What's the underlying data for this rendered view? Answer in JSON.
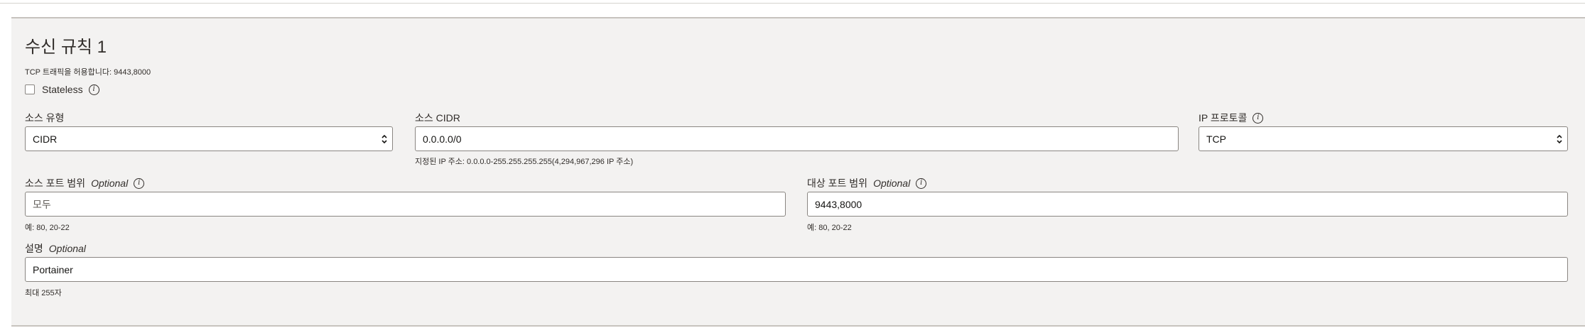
{
  "rule": {
    "title": "수신 규칙 1",
    "summary": "TCP 트래픽을 허용합니다: 9443,8000",
    "stateless_label": "Stateless"
  },
  "source_type": {
    "label": "소스 유형",
    "value": "CIDR"
  },
  "source_cidr": {
    "label": "소스 CIDR",
    "value": "0.0.0.0/0",
    "hint": "지정된 IP 주소: 0.0.0.0-255.255.255.255(4,294,967,296 IP 주소)"
  },
  "ip_protocol": {
    "label": "IP 프로토콜",
    "value": "TCP"
  },
  "source_port": {
    "label": "소스 포트 범위",
    "optional": "Optional",
    "placeholder": "모두",
    "hint": "예: 80, 20-22"
  },
  "dest_port": {
    "label": "대상 포트 범위",
    "optional": "Optional",
    "value": "9443,8000",
    "hint": "예: 80, 20-22"
  },
  "description": {
    "label": "설명",
    "optional": "Optional",
    "value": "Portainer",
    "hint": "최대 255자"
  },
  "icons": {
    "info": "info-icon",
    "select": "select-arrows-icon"
  }
}
